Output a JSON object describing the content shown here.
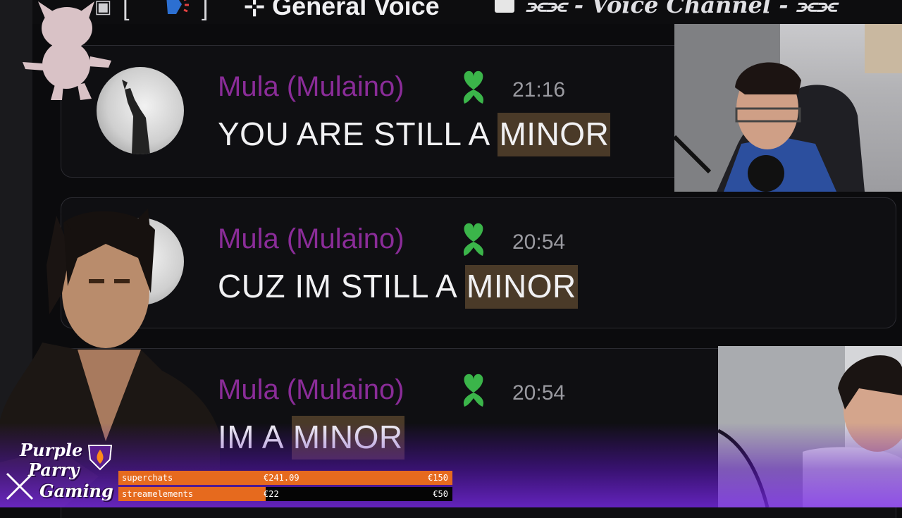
{
  "channel_header": {
    "title": "⊹ General Voice",
    "subtitle": "⫘⫘ - Voice Channel - ⫘⫘"
  },
  "messages": [
    {
      "username": "Mula (Mulaino)",
      "time": "21:16",
      "text_prefix": "YOU ARE STILL A ",
      "text_highlight": "MINOR"
    },
    {
      "username": "Mula (Mulaino)",
      "time": "20:54",
      "text_prefix": "CUZ IM  STILL A ",
      "text_highlight": "MINOR"
    },
    {
      "username": "Mula (Mulaino)",
      "time": "20:54",
      "text_prefix": "IM A ",
      "text_highlight": "MINOR"
    }
  ],
  "overlay": {
    "logo_lines": [
      "Purple",
      "Parry",
      "Gaming"
    ],
    "goals": [
      {
        "label": "superchats",
        "value": "€241.09",
        "goal": "€150",
        "progress": 1.0
      },
      {
        "label": "streamelements",
        "value": "€22",
        "goal": "€50",
        "progress": 0.44
      }
    ]
  },
  "colors": {
    "username": "#8a2c98",
    "badge": "#3bb54a",
    "highlight": "#4a3a28",
    "bar_fill": "#e66a1e"
  }
}
